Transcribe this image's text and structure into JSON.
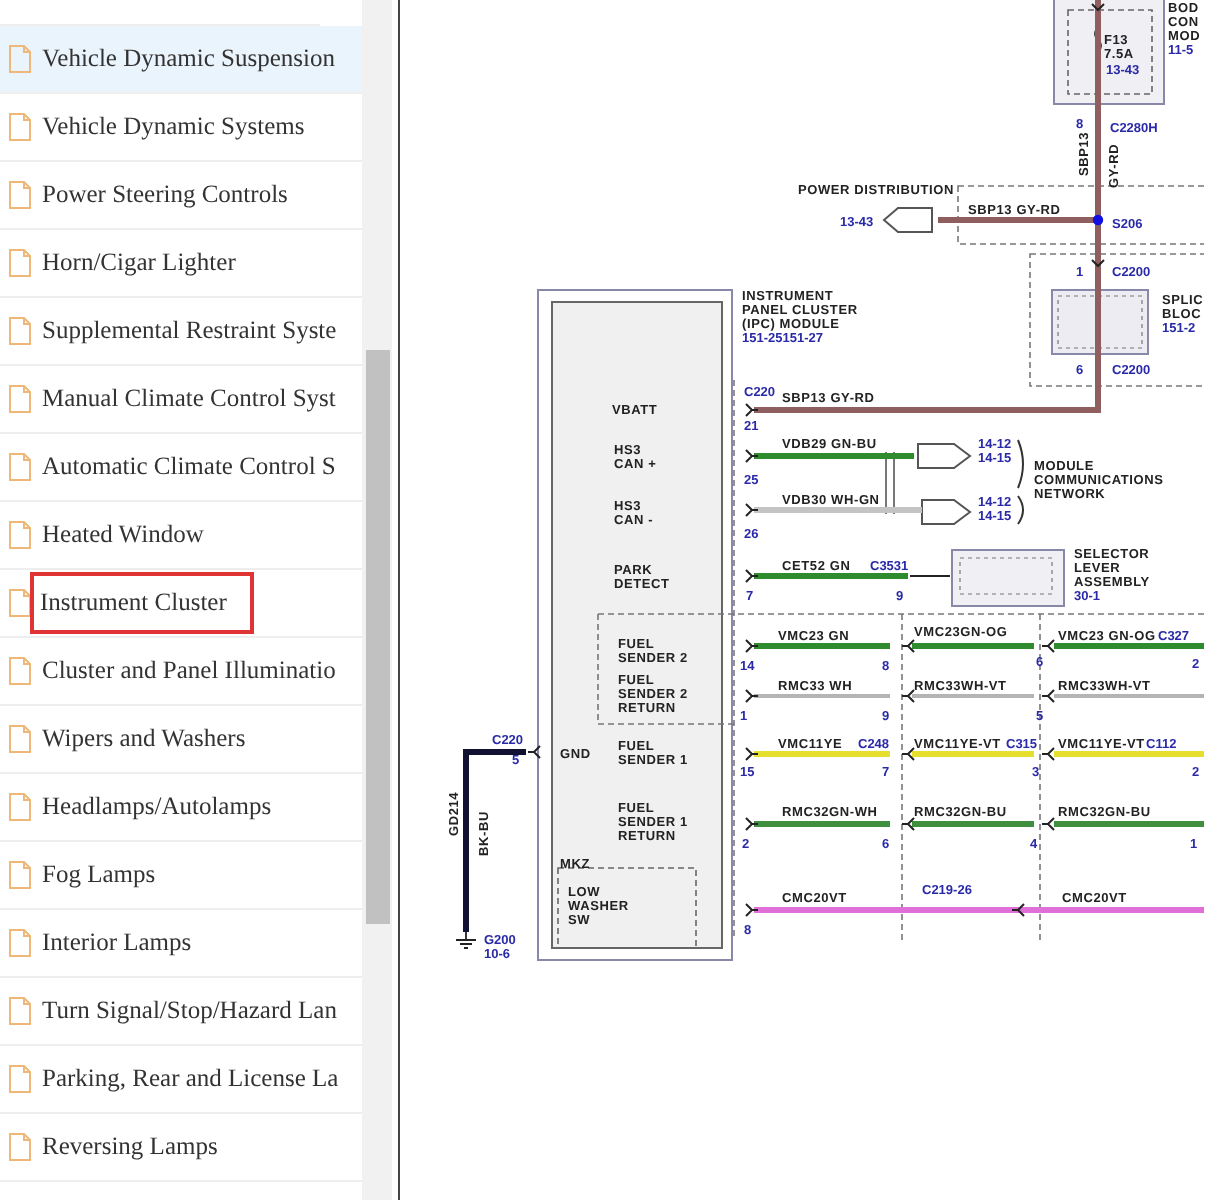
{
  "sidebar": {
    "items": [
      {
        "label": "Vehicle Dynamic Suspension",
        "highlighted": true,
        "selected": false
      },
      {
        "label": "Vehicle Dynamic Systems",
        "highlighted": false,
        "selected": false
      },
      {
        "label": "Power Steering Controls",
        "highlighted": false,
        "selected": false
      },
      {
        "label": "Horn/Cigar Lighter",
        "highlighted": false,
        "selected": false
      },
      {
        "label": "Supplemental Restraint Syste",
        "highlighted": false,
        "selected": false
      },
      {
        "label": "Manual Climate Control Syst",
        "highlighted": false,
        "selected": false
      },
      {
        "label": "Automatic Climate Control S",
        "highlighted": false,
        "selected": false
      },
      {
        "label": "Heated Window",
        "highlighted": false,
        "selected": false
      },
      {
        "label": "Instrument Cluster",
        "highlighted": false,
        "selected": true
      },
      {
        "label": "Cluster and Panel Illuminatio",
        "highlighted": false,
        "selected": false
      },
      {
        "label": "Wipers and Washers",
        "highlighted": false,
        "selected": false
      },
      {
        "label": "Headlamps/Autolamps",
        "highlighted": false,
        "selected": false
      },
      {
        "label": "Fog Lamps",
        "highlighted": false,
        "selected": false
      },
      {
        "label": "Interior Lamps",
        "highlighted": false,
        "selected": false
      },
      {
        "label": "Turn Signal/Stop/Hazard Lan",
        "highlighted": false,
        "selected": false
      },
      {
        "label": "Parking, Rear and License La",
        "highlighted": false,
        "selected": false
      },
      {
        "label": "Reversing Lamps",
        "highlighted": false,
        "selected": false
      }
    ]
  },
  "diagram": {
    "wires": [
      {
        "color": "#8f5f5f"
      },
      {
        "color": "#2e8b2e"
      },
      {
        "color": "#c4c4c4"
      },
      {
        "color": "#2e8b2e"
      },
      {
        "color": "#2e8b2e"
      },
      {
        "color": "#b4b4b4"
      },
      {
        "color": "#e6df2e"
      },
      {
        "color": "#3f8f3f"
      },
      {
        "color": "#e070d8"
      },
      {
        "color": "#111133"
      }
    ],
    "labels": [
      {
        "t": "BOD",
        "kind": "label"
      },
      {
        "t": "CON",
        "kind": "label"
      },
      {
        "t": "MOD",
        "kind": "label"
      },
      {
        "t": "11-5",
        "kind": "ref"
      },
      {
        "t": "F13",
        "kind": "label"
      },
      {
        "t": "7.5A",
        "kind": "label"
      },
      {
        "t": "13-43",
        "kind": "ref"
      },
      {
        "t": "8",
        "kind": "ref"
      },
      {
        "t": "C2280H",
        "kind": "ref"
      },
      {
        "t": "SBP13",
        "kind": "label"
      },
      {
        "t": "GY-RD",
        "kind": "label"
      },
      {
        "t": "POWER DISTRIBUTION",
        "kind": "label"
      },
      {
        "t": "13-43",
        "kind": "ref"
      },
      {
        "t": "SBP13  GY-RD",
        "kind": "label"
      },
      {
        "t": "S206",
        "kind": "ref"
      },
      {
        "t": "1",
        "kind": "ref"
      },
      {
        "t": "C2200",
        "kind": "ref"
      },
      {
        "t": "SPLIC",
        "kind": "label"
      },
      {
        "t": "BLOC",
        "kind": "label"
      },
      {
        "t": "151-2",
        "kind": "ref"
      },
      {
        "t": "6",
        "kind": "ref"
      },
      {
        "t": "C2200",
        "kind": "ref"
      },
      {
        "t": "INSTRUMENT",
        "kind": "label"
      },
      {
        "t": "PANEL CLUSTER",
        "kind": "label"
      },
      {
        "t": "(IPC) MODULE",
        "kind": "label"
      },
      {
        "t": "151-25151-27",
        "kind": "ref"
      },
      {
        "t": "VBATT",
        "kind": "label"
      },
      {
        "t": "C220",
        "kind": "ref"
      },
      {
        "t": "SBP13 GY-RD",
        "kind": "label"
      },
      {
        "t": "21",
        "kind": "ref"
      },
      {
        "t": "HS3",
        "kind": "label"
      },
      {
        "t": "CAN +",
        "kind": "label"
      },
      {
        "t": "VDB29 GN-BU",
        "kind": "label"
      },
      {
        "t": "25",
        "kind": "ref"
      },
      {
        "t": "14-12",
        "kind": "ref"
      },
      {
        "t": "14-15",
        "kind": "ref"
      },
      {
        "t": "MODULE",
        "kind": "label"
      },
      {
        "t": "COMMUNICATIONS",
        "kind": "label"
      },
      {
        "t": "NETWORK",
        "kind": "label"
      },
      {
        "t": "HS3",
        "kind": "label"
      },
      {
        "t": "CAN -",
        "kind": "label"
      },
      {
        "t": "VDB30 WH-GN",
        "kind": "label"
      },
      {
        "t": "14-12",
        "kind": "ref"
      },
      {
        "t": "14-15",
        "kind": "ref"
      },
      {
        "t": "26",
        "kind": "ref"
      },
      {
        "t": "PARK",
        "kind": "label"
      },
      {
        "t": "DETECT",
        "kind": "label"
      },
      {
        "t": "CET52 GN",
        "kind": "label"
      },
      {
        "t": "C3531",
        "kind": "ref"
      },
      {
        "t": "7",
        "kind": "ref"
      },
      {
        "t": "9",
        "kind": "ref"
      },
      {
        "t": "SELECTOR",
        "kind": "label"
      },
      {
        "t": "LEVER",
        "kind": "label"
      },
      {
        "t": "ASSEMBLY",
        "kind": "label"
      },
      {
        "t": "30-1",
        "kind": "ref"
      },
      {
        "t": "FUEL",
        "kind": "label"
      },
      {
        "t": "SENDER 2",
        "kind": "label"
      },
      {
        "t": "VMC23 GN",
        "kind": "label"
      },
      {
        "t": "VMC23GN-OG",
        "kind": "label"
      },
      {
        "t": "VMC23 GN-OG",
        "kind": "label"
      },
      {
        "t": "C327",
        "kind": "ref"
      },
      {
        "t": "14",
        "kind": "ref"
      },
      {
        "t": "8",
        "kind": "ref"
      },
      {
        "t": "6",
        "kind": "ref"
      },
      {
        "t": "2",
        "kind": "ref"
      },
      {
        "t": "FUEL",
        "kind": "label"
      },
      {
        "t": "SENDER 2",
        "kind": "label"
      },
      {
        "t": "RETURN",
        "kind": "label"
      },
      {
        "t": "RMC33 WH",
        "kind": "label"
      },
      {
        "t": "RMC33WH-VT",
        "kind": "label"
      },
      {
        "t": "RMC33WH-VT",
        "kind": "label"
      },
      {
        "t": "1",
        "kind": "ref"
      },
      {
        "t": "9",
        "kind": "ref"
      },
      {
        "t": "5",
        "kind": "ref"
      },
      {
        "t": "C220",
        "kind": "ref"
      },
      {
        "t": "5",
        "kind": "ref"
      },
      {
        "t": "GND",
        "kind": "label"
      },
      {
        "t": "FUEL",
        "kind": "label"
      },
      {
        "t": "SENDER 1",
        "kind": "label"
      },
      {
        "t": "VMC11YE",
        "kind": "label"
      },
      {
        "t": "C248",
        "kind": "ref"
      },
      {
        "t": "VMC11YE-VT",
        "kind": "label"
      },
      {
        "t": "C315",
        "kind": "ref"
      },
      {
        "t": "VMC11YE-VT",
        "kind": "label"
      },
      {
        "t": "C112",
        "kind": "ref"
      },
      {
        "t": "15",
        "kind": "ref"
      },
      {
        "t": "7",
        "kind": "ref"
      },
      {
        "t": "3",
        "kind": "ref"
      },
      {
        "t": "2",
        "kind": "ref"
      },
      {
        "t": "FUEL",
        "kind": "label"
      },
      {
        "t": "SENDER 1",
        "kind": "label"
      },
      {
        "t": "RETURN",
        "kind": "label"
      },
      {
        "t": "RMC32GN-WH",
        "kind": "label"
      },
      {
        "t": "RMC32GN-BU",
        "kind": "label"
      },
      {
        "t": "RMC32GN-BU",
        "kind": "label"
      },
      {
        "t": "2",
        "kind": "ref"
      },
      {
        "t": "6",
        "kind": "ref"
      },
      {
        "t": "4",
        "kind": "ref"
      },
      {
        "t": "1",
        "kind": "ref"
      },
      {
        "t": "GD214",
        "kind": "label"
      },
      {
        "t": "BK-BU",
        "kind": "label"
      },
      {
        "t": "MKZ",
        "kind": "label"
      },
      {
        "t": "LOW",
        "kind": "label"
      },
      {
        "t": "WASHER",
        "kind": "label"
      },
      {
        "t": "SW",
        "kind": "label"
      },
      {
        "t": "G200",
        "kind": "ref"
      },
      {
        "t": "10-6",
        "kind": "ref"
      },
      {
        "t": "CMC20VT",
        "kind": "label"
      },
      {
        "t": "C219-26",
        "kind": "ref"
      },
      {
        "t": "CMC20VT",
        "kind": "label"
      },
      {
        "t": "8",
        "kind": "ref"
      }
    ]
  }
}
